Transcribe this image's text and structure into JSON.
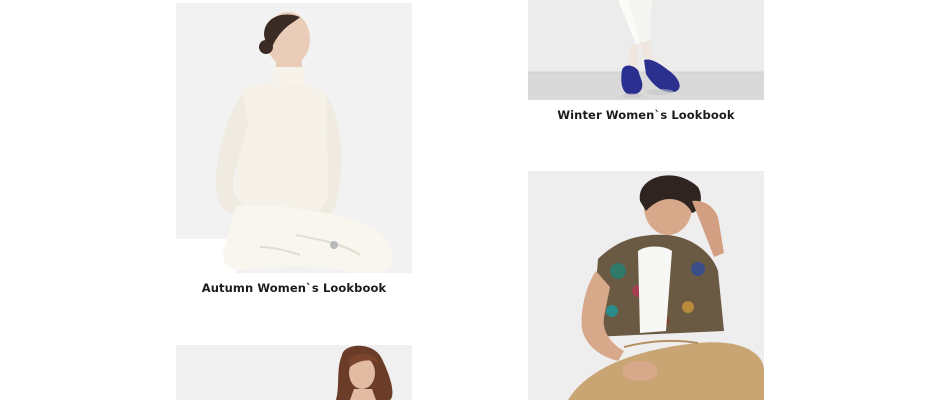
{
  "lookbooks": [
    {
      "title": "Winter Women`s Lookbook",
      "image_alt": "Woman in white trousers and navy suede loafers"
    },
    {
      "title": "Autumn Women`s Lookbook",
      "image_alt": "Woman in cream turtleneck sweater and white trousers seated"
    },
    {
      "title": "",
      "image_alt": "Man in floral short-sleeve shirt and khaki trousers seated"
    },
    {
      "title": "",
      "image_alt": "Woman with long wavy auburn hair"
    }
  ]
}
